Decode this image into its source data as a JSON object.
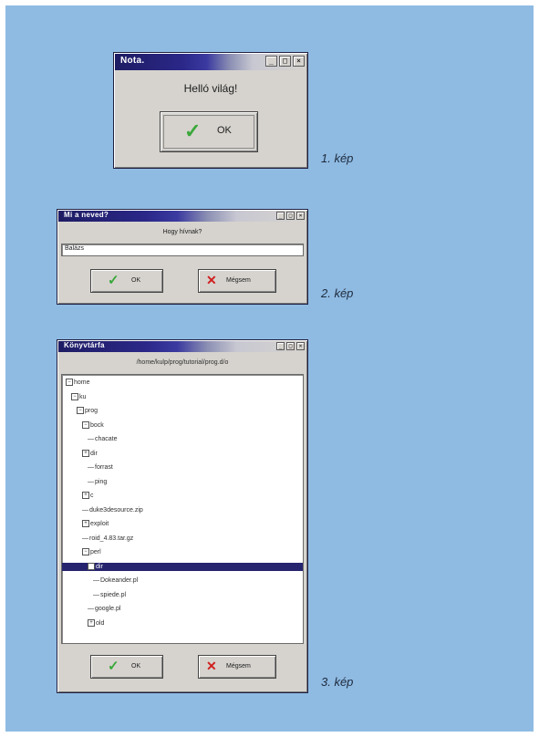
{
  "colors": {
    "page_background": "#8fbbe3",
    "titlebar_dark": "#1e1c63",
    "window_bg": "#d6d3ce",
    "check_green": "#3aa83a",
    "cross_red": "#d02020",
    "selection": "#26246e"
  },
  "dialog1": {
    "title": "Nota.",
    "message": "Helló világ!",
    "ok_label": "OK",
    "caption": "1. kép",
    "buttons": [
      "minimize",
      "maximize",
      "close"
    ]
  },
  "dialog2": {
    "title": "Mi a neved?",
    "prompt": "Hogy hívnak?",
    "input_value": "Balázs",
    "ok_label": "OK",
    "cancel_label": "Mégsem",
    "caption": "2. kép"
  },
  "dialog3": {
    "title": "Könyvtárfa",
    "path": "/home/kulp/prog/tutorial/prog.d/o",
    "ok_label": "OK",
    "cancel_label": "Mégsem",
    "caption": "3. kép",
    "tree": [
      {
        "label": "home",
        "toggle": "−"
      },
      {
        "label": "ku",
        "toggle": "−"
      },
      {
        "label": "prog",
        "toggle": "−"
      },
      {
        "label": "bock",
        "toggle": "−"
      },
      {
        "label": "chacate",
        "toggle": ""
      },
      {
        "label": "dir",
        "toggle": "+"
      },
      {
        "label": "forrast",
        "toggle": ""
      },
      {
        "label": "ping",
        "toggle": ""
      },
      {
        "label": "c",
        "toggle": "+"
      },
      {
        "label": "duke3desource.zip",
        "toggle": ""
      },
      {
        "label": "exploit",
        "toggle": "+"
      },
      {
        "label": "roid_4.83.tar.gz",
        "toggle": ""
      },
      {
        "label": "perl",
        "toggle": "−"
      },
      {
        "label": "dir",
        "toggle": "−",
        "selected": true
      },
      {
        "label": "Dokeander.pl",
        "toggle": ""
      },
      {
        "label": "spiede.pl",
        "toggle": ""
      },
      {
        "label": "google.pl",
        "toggle": ""
      },
      {
        "label": "old",
        "toggle": "+"
      }
    ]
  }
}
